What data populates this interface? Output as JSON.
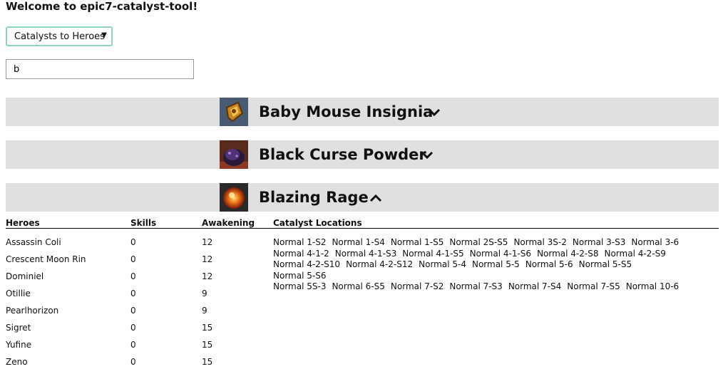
{
  "app": {
    "title": "Welcome to epic7-catalyst-tool!"
  },
  "mode_select": {
    "value": "Catalysts to Heroes",
    "arrow": "▼"
  },
  "search": {
    "value": "b"
  },
  "catalysts": [
    {
      "name": "Baby Mouse Insignia",
      "expanded": false,
      "icon": "baby-mouse-insignia-icon"
    },
    {
      "name": "Black Curse Powder",
      "expanded": false,
      "icon": "black-curse-powder-icon"
    },
    {
      "name": "Blazing Rage",
      "expanded": true,
      "icon": "blazing-rage-icon"
    }
  ],
  "table": {
    "headers": {
      "heroes": "Heroes",
      "skills": "Skills",
      "awakening": "Awakening",
      "locations": "Catalyst Locations"
    },
    "rows": [
      {
        "hero": "Assassin Coli",
        "skills": "0",
        "awakening": "12"
      },
      {
        "hero": "Crescent Moon Rin",
        "skills": "0",
        "awakening": "12"
      },
      {
        "hero": "Dominiel",
        "skills": "0",
        "awakening": "12"
      },
      {
        "hero": "Otillie",
        "skills": "0",
        "awakening": "9"
      },
      {
        "hero": "Pearlhorizon",
        "skills": "0",
        "awakening": "9"
      },
      {
        "hero": "Sigret",
        "skills": "0",
        "awakening": "15"
      },
      {
        "hero": "Yufine",
        "skills": "0",
        "awakening": "15"
      },
      {
        "hero": "Zeno",
        "skills": "0",
        "awakening": "15"
      }
    ],
    "locations": [
      "Normal 1-S2",
      "Normal 1-S4",
      "Normal 1-S5",
      "Normal 2S-S5",
      "Normal 3S-2",
      "Normal 3-S3",
      "Normal 3-6",
      "Normal 4-1-2",
      "Normal 4-1-S3",
      "Normal 4-1-S5",
      "Normal 4-1-S6",
      "Normal 4-2-S8",
      "Normal 4-2-S9",
      "Normal 4-2-S10",
      "Normal 4-2-S12",
      "Normal 5-4",
      "Normal 5-5",
      "Normal 5-6",
      "Normal 5-S5",
      "Normal 5-S6",
      "Normal 5S-3",
      "Normal 6-S5",
      "Normal 7-S2",
      "Normal 7-S3",
      "Normal 7-S4",
      "Normal 7-S5",
      "Normal 10-6"
    ]
  },
  "colors": {
    "bar": "#e0e0e0",
    "select_border": "#8fd3c4"
  }
}
